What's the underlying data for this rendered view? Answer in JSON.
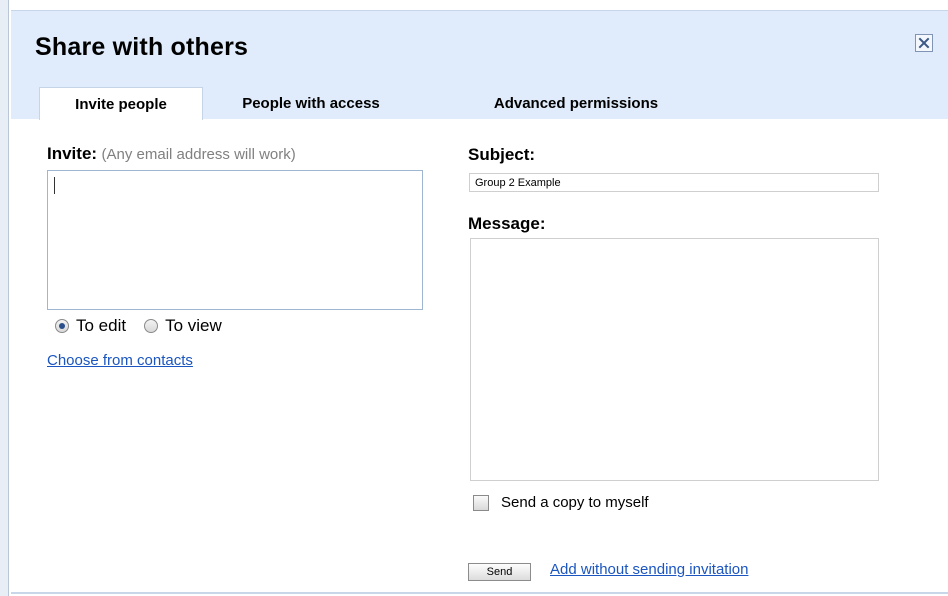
{
  "dialog": {
    "title": "Share with others",
    "close_icon": "close-x-icon"
  },
  "tabs": [
    {
      "label": "Invite people",
      "active": true
    },
    {
      "label": "People with access",
      "active": false
    },
    {
      "label": "Advanced permissions",
      "active": false
    }
  ],
  "invite": {
    "label": "Invite:",
    "hint": "(Any email address will work)",
    "value": ""
  },
  "permissions": {
    "options": [
      {
        "label": "To edit",
        "checked": true
      },
      {
        "label": "To view",
        "checked": false
      }
    ]
  },
  "contacts_link": "Choose from contacts",
  "subject": {
    "label": "Subject:",
    "value": "Group 2 Example"
  },
  "message": {
    "label": "Message:",
    "value": ""
  },
  "copy_to_self": {
    "label": "Send a copy to myself",
    "checked": false
  },
  "actions": {
    "send_label": "Send",
    "add_without_label": "Add without sending invitation"
  },
  "colors": {
    "header_bg": "#e0ecfb",
    "link": "#1a55c0",
    "hint": "#808080"
  }
}
